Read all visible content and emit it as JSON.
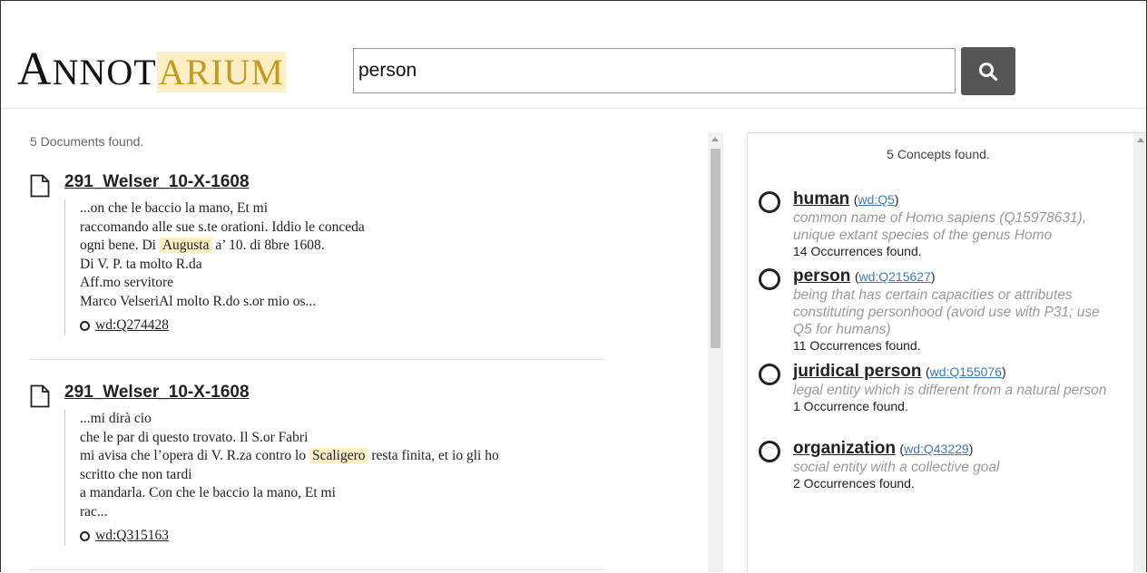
{
  "logo": {
    "first_cap": "A",
    "first_rest": "NNOT",
    "hl_cap": "ARIUM"
  },
  "search": {
    "value": "person",
    "button_icon": "search-icon"
  },
  "results": {
    "count_text": "5 Documents found.",
    "documents": [
      {
        "title": "291_Welser_10-X-1608",
        "lines": [
          {
            "pre": "...on che le baccio la mano, Et mi",
            "mark": "",
            "post": ""
          },
          {
            "pre": "raccomando alle sue s.te orationi. Iddio le conceda",
            "mark": "",
            "post": ""
          },
          {
            "pre": "ogni bene. Di ",
            "mark": "Augusta",
            "post": " a’ 10. di 8bre 1608."
          },
          {
            "pre": "Di V. P. ta molto R.da",
            "mark": "",
            "post": ""
          },
          {
            "pre": "Aff.mo servitore",
            "mark": "",
            "post": ""
          },
          {
            "pre": "Marco VelseriAl molto R.do s.or mio os...",
            "mark": "",
            "post": ""
          }
        ],
        "wd_link": "wd:Q274428"
      },
      {
        "title": "291_Welser_10-X-1608",
        "lines": [
          {
            "pre": "...mi dirà cio",
            "mark": "",
            "post": ""
          },
          {
            "pre": "che le par di questo trovato. Il S.or Fabri",
            "mark": "",
            "post": ""
          },
          {
            "pre": "mi avisa che l’opera di V. R.za contro lo ",
            "mark": "Scaligero",
            "post": " resta finita, et io gli ho"
          },
          {
            "pre": "scritto che non tardi",
            "mark": "",
            "post": ""
          },
          {
            "pre": "a mandarla. Con che le baccio la mano, Et mi",
            "mark": "",
            "post": ""
          },
          {
            "pre": "rac...",
            "mark": "",
            "post": ""
          }
        ],
        "wd_link": "wd:Q315163"
      }
    ]
  },
  "concepts": {
    "count_text": "5 Concepts found.",
    "items": [
      {
        "name": "human",
        "id": "wd:Q5",
        "desc": "common name of Homo sapiens (Q15978631), unique extant species of the genus Homo",
        "occ": "14 Occurrences found."
      },
      {
        "name": "person",
        "id": "wd:Q215627",
        "desc": "being that has certain capacities or attributes constituting personhood (avoid use with P31; use Q5 for humans)",
        "occ": "11 Occurrences found."
      },
      {
        "name": "juridical person",
        "id": "wd:Q155076",
        "desc": "legal entity which is different from a natural person",
        "occ": "1 Occurrence found."
      },
      {
        "name": "organization",
        "id": "wd:Q43229",
        "desc": "social entity with a collective goal",
        "occ": "2 Occurrences found."
      }
    ]
  },
  "colors": {
    "highlight": "#fdefc3",
    "logo_gold": "#c49a24",
    "link_blue": "#3a7bbf",
    "button": "#555555"
  }
}
